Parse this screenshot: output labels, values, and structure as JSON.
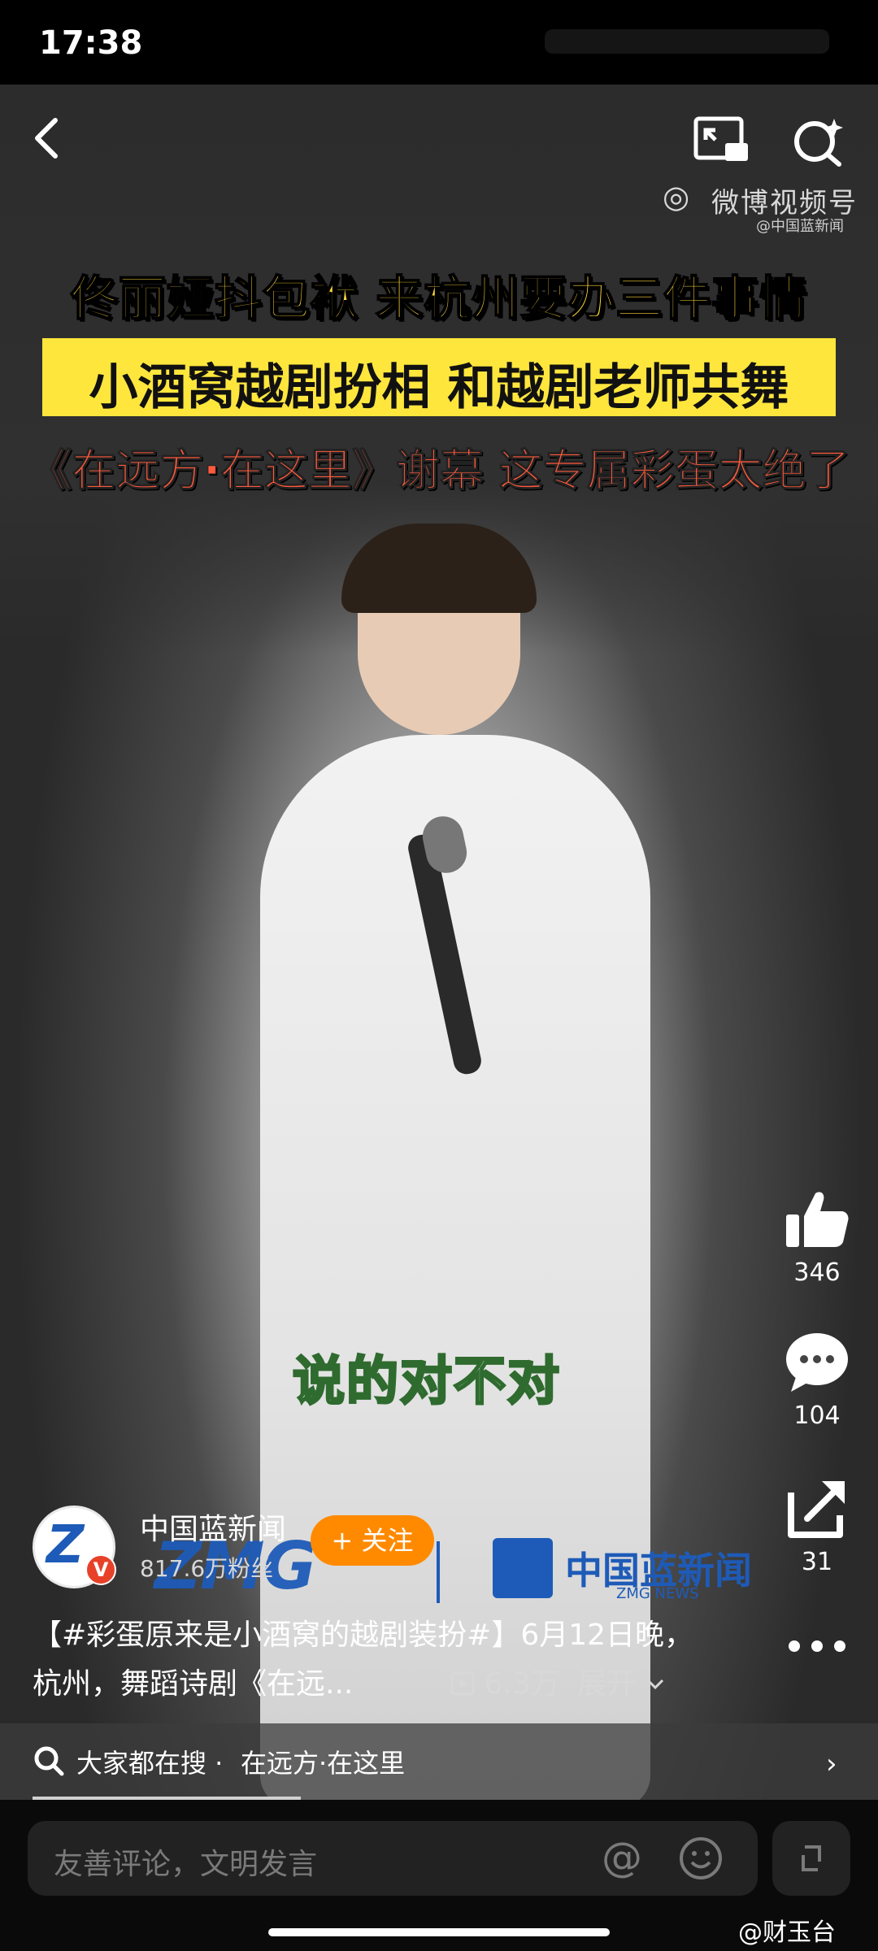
{
  "status_bar": {
    "time": "17:38"
  },
  "video": {
    "source_watermark": {
      "platform": "微博视频号",
      "handle": "@中国蓝新闻"
    },
    "headline": {
      "line1": "佟丽娅抖包袱 来杭州要办三件事情",
      "line2": "小酒窝越剧扮相 和越剧老师共舞",
      "line3": "《在远方·在这里》谢幕 这专属彩蛋太绝了"
    },
    "subtitle": "说的对不对",
    "brand_watermark": {
      "logo": "ZMG",
      "name": "中国蓝新闻",
      "sub": "ZMG NEWS"
    }
  },
  "actions": {
    "like_count": "346",
    "comment_count": "104",
    "share_count": "31"
  },
  "author": {
    "name": "中国蓝新闻",
    "fans": "817.6万粉丝",
    "follow_label": "+ 关注",
    "verified_badge": "V"
  },
  "description": {
    "text": "【#彩蛋原来是小酒窝的越剧装扮#】6月12日晚，杭州，舞蹈诗剧《在远...",
    "views": "6.3万",
    "expand_label": "展开"
  },
  "search_bar": {
    "prefix": "大家都在搜 ·",
    "term": "在远方·在这里"
  },
  "comment_bar": {
    "placeholder": "友善评论，文明发言"
  },
  "corner_watermark": "@财玉台",
  "colors": {
    "follow_button": "#ff8a00",
    "headline_yellow": "#ffd83a",
    "headline_red": "#ff5a3c",
    "brand_blue": "#1e5bb8"
  },
  "icons": [
    "back-icon",
    "pip-icon",
    "search-icon",
    "like-icon",
    "comment-icon",
    "share-icon",
    "more-icon",
    "at-icon",
    "emoji-icon",
    "expand-icon"
  ]
}
